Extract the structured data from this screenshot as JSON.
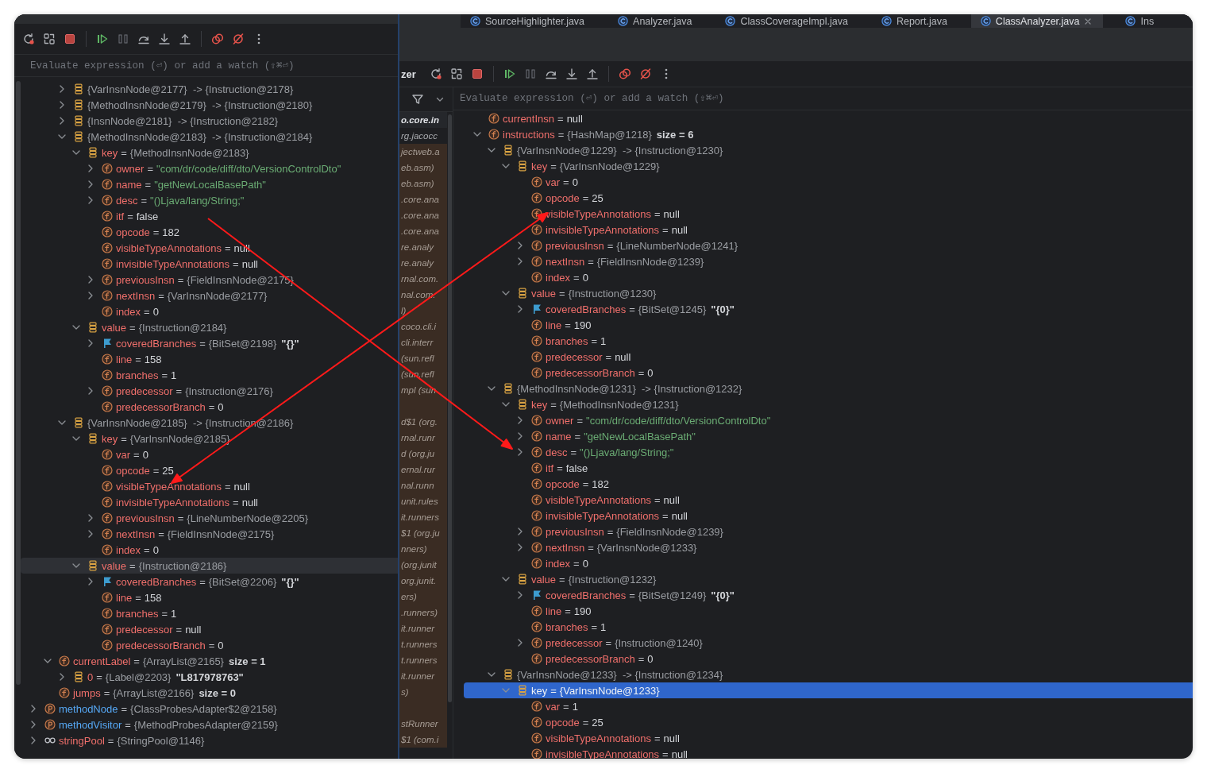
{
  "left_panel": {
    "focused": false,
    "evaluate_field": {
      "placeholder": "Evaluate expression (⏎) or add a watch (⇧⌘⏎)"
    },
    "tree": [
      {
        "children": [
          {
            "children": [
              {
                "kind": "entry",
                "value": {
                  "kind": "object",
                  "text": "{VarInsnNode@2177}  -> {Instruction@2178}"
                },
                "expanded": false,
                "selected": false
              },
              {
                "kind": "entry",
                "value": {
                  "kind": "object",
                  "text": "{MethodInsnNode@2179}  -> {Instruction@2180}"
                },
                "expanded": false,
                "selected": false
              },
              {
                "kind": "entry",
                "value": {
                  "kind": "object",
                  "text": "{InsnNode@2181}  -> {Instruction@2182}"
                },
                "expanded": false,
                "selected": false
              },
              {
                "kind": "entry",
                "value": {
                  "kind": "object",
                  "text": "{MethodInsnNode@2183}  -> {Instruction@2184}"
                },
                "expanded": true,
                "selected": false,
                "children": [
                  {
                    "kind": "entry",
                    "name": "key",
                    "sep": "=",
                    "value": {
                      "kind": "object",
                      "text": "{MethodInsnNode@2183}"
                    },
                    "expanded": true,
                    "selected": false,
                    "children": [
                      {
                        "kind": "field",
                        "name": "owner",
                        "sep": "=",
                        "value": {
                          "kind": "string",
                          "text": "\"com/dr/code/diff/dto/VersionControlDto\""
                        },
                        "expanded": false,
                        "selected": false
                      },
                      {
                        "kind": "field",
                        "name": "name",
                        "sep": "=",
                        "value": {
                          "kind": "string",
                          "text": "\"getNewLocalBasePath\""
                        },
                        "expanded": false,
                        "selected": false
                      },
                      {
                        "kind": "field",
                        "name": "desc",
                        "sep": "=",
                        "value": {
                          "kind": "string",
                          "text": "\"()Ljava/lang/String;\""
                        },
                        "expanded": false,
                        "selected": false
                      },
                      {
                        "kind": "field",
                        "name": "itf",
                        "sep": "=",
                        "value": {
                          "kind": "literal",
                          "text": "false"
                        },
                        "selected": false
                      },
                      {
                        "kind": "field",
                        "name": "opcode",
                        "sep": "=",
                        "value": {
                          "kind": "literal",
                          "text": "182"
                        },
                        "selected": false
                      },
                      {
                        "kind": "field",
                        "name": "visibleTypeAnnotations",
                        "sep": "=",
                        "value": {
                          "kind": "literal",
                          "text": "null"
                        },
                        "selected": false
                      },
                      {
                        "kind": "field",
                        "name": "invisibleTypeAnnotations",
                        "sep": "=",
                        "value": {
                          "kind": "literal",
                          "text": "null"
                        },
                        "selected": false
                      },
                      {
                        "kind": "field",
                        "name": "previousInsn",
                        "sep": "=",
                        "value": {
                          "kind": "object",
                          "text": "{FieldInsnNode@2175}"
                        },
                        "expanded": false,
                        "selected": false
                      },
                      {
                        "kind": "field",
                        "name": "nextInsn",
                        "sep": "=",
                        "value": {
                          "kind": "object",
                          "text": "{VarInsnNode@2177}"
                        },
                        "expanded": false,
                        "selected": false
                      },
                      {
                        "kind": "field",
                        "name": "index",
                        "sep": "=",
                        "value": {
                          "kind": "literal",
                          "text": "0"
                        },
                        "selected": false
                      }
                    ]
                  },
                  {
                    "kind": "entry",
                    "name": "value",
                    "sep": "=",
                    "value": {
                      "kind": "object",
                      "text": "{Instruction@2184}"
                    },
                    "expanded": true,
                    "selected": false,
                    "children": [
                      {
                        "kind": "flag",
                        "name": "coveredBranches",
                        "sep": "=",
                        "value": {
                          "kind": "object",
                          "text": "{BitSet@2198}"
                        },
                        "extra": "\"{}\"",
                        "expanded": false,
                        "selected": false
                      },
                      {
                        "kind": "field",
                        "name": "line",
                        "sep": "=",
                        "value": {
                          "kind": "literal",
                          "text": "158"
                        },
                        "selected": false
                      },
                      {
                        "kind": "field",
                        "name": "branches",
                        "sep": "=",
                        "value": {
                          "kind": "literal",
                          "text": "1"
                        },
                        "selected": false
                      },
                      {
                        "kind": "field",
                        "name": "predecessor",
                        "sep": "=",
                        "value": {
                          "kind": "object",
                          "text": "{Instruction@2176}"
                        },
                        "expanded": false,
                        "selected": false
                      },
                      {
                        "kind": "field",
                        "name": "predecessorBranch",
                        "sep": "=",
                        "value": {
                          "kind": "literal",
                          "text": "0"
                        },
                        "selected": false
                      }
                    ]
                  }
                ]
              },
              {
                "kind": "entry",
                "value": {
                  "kind": "object",
                  "text": "{VarInsnNode@2185}  -> {Instruction@2186}"
                },
                "expanded": true,
                "selected": false,
                "children": [
                  {
                    "kind": "entry",
                    "name": "key",
                    "sep": "=",
                    "value": {
                      "kind": "object",
                      "text": "{VarInsnNode@2185}"
                    },
                    "expanded": true,
                    "selected": false,
                    "children": [
                      {
                        "kind": "field",
                        "name": "var",
                        "sep": "=",
                        "value": {
                          "kind": "literal",
                          "text": "0"
                        },
                        "selected": false
                      },
                      {
                        "kind": "field",
                        "name": "opcode",
                        "sep": "=",
                        "value": {
                          "kind": "literal",
                          "text": "25"
                        },
                        "selected": false
                      },
                      {
                        "kind": "field",
                        "name": "visibleTypeAnnotations",
                        "sep": "=",
                        "value": {
                          "kind": "literal",
                          "text": "null"
                        },
                        "selected": false
                      },
                      {
                        "kind": "field",
                        "name": "invisibleTypeAnnotations",
                        "sep": "=",
                        "value": {
                          "kind": "literal",
                          "text": "null"
                        },
                        "selected": false
                      },
                      {
                        "kind": "field",
                        "name": "previousInsn",
                        "sep": "=",
                        "value": {
                          "kind": "object",
                          "text": "{LineNumberNode@2205}"
                        },
                        "expanded": false,
                        "selected": false
                      },
                      {
                        "kind": "field",
                        "name": "nextInsn",
                        "sep": "=",
                        "value": {
                          "kind": "object",
                          "text": "{FieldInsnNode@2175}"
                        },
                        "expanded": false,
                        "selected": false
                      },
                      {
                        "kind": "field",
                        "name": "index",
                        "sep": "=",
                        "value": {
                          "kind": "literal",
                          "text": "0"
                        },
                        "selected": false
                      }
                    ]
                  },
                  {
                    "kind": "entry",
                    "name": "value",
                    "sep": "=",
                    "value": {
                      "kind": "object",
                      "text": "{Instruction@2186}"
                    },
                    "expanded": true,
                    "selected": true,
                    "children": [
                      {
                        "kind": "flag",
                        "name": "coveredBranches",
                        "sep": "=",
                        "value": {
                          "kind": "object",
                          "text": "{BitSet@2206}"
                        },
                        "extra": "\"{}\"",
                        "expanded": false,
                        "selected": false
                      },
                      {
                        "kind": "field",
                        "name": "line",
                        "sep": "=",
                        "value": {
                          "kind": "literal",
                          "text": "158"
                        },
                        "selected": false
                      },
                      {
                        "kind": "field",
                        "name": "branches",
                        "sep": "=",
                        "value": {
                          "kind": "literal",
                          "text": "1"
                        },
                        "selected": false
                      },
                      {
                        "kind": "field",
                        "name": "predecessor",
                        "sep": "=",
                        "value": {
                          "kind": "literal",
                          "text": "null"
                        },
                        "selected": false
                      },
                      {
                        "kind": "field",
                        "name": "predecessorBranch",
                        "sep": "=",
                        "value": {
                          "kind": "literal",
                          "text": "0"
                        },
                        "selected": false
                      }
                    ]
                  }
                ]
              }
            ]
          },
          {
            "kind": "field",
            "name": "currentLabel",
            "sep": "=",
            "value": {
              "kind": "object",
              "text": "{ArrayList@2165}"
            },
            "extra": "size = 1",
            "expanded": true,
            "selected": false,
            "children": [
              {
                "kind": "entry",
                "name": "0",
                "sep": "=",
                "value": {
                  "kind": "object",
                  "text": "{Label@2203}"
                },
                "extra": "\"L817978763\"",
                "expanded": false,
                "selected": false
              }
            ]
          },
          {
            "kind": "field",
            "name": "jumps",
            "sep": "=",
            "value": {
              "kind": "object",
              "text": "{ArrayList@2166}"
            },
            "extra": "size = 0",
            "selected": false
          }
        ]
      },
      {
        "kind": "protected",
        "name": "methodNode",
        "sep": "=",
        "value": {
          "kind": "object",
          "text": "{ClassProbesAdapter$2@2158}"
        },
        "expanded": false,
        "selected": false
      },
      {
        "kind": "protected",
        "name": "methodVisitor",
        "sep": "=",
        "value": {
          "kind": "object",
          "text": "{MethodProbesAdapter@2159}"
        },
        "expanded": false,
        "selected": false
      },
      {
        "kind": "watch",
        "name": "stringPool",
        "sep": "=",
        "value": {
          "kind": "object",
          "text": "{StringPool@1146}"
        },
        "expanded": false,
        "selected": false
      }
    ]
  },
  "right_window": {
    "tabs": [
      {
        "label": "SourceHighlighter.java",
        "selected": false
      },
      {
        "label": "Analyzer.java",
        "selected": false
      },
      {
        "label": "ClassCoverageImpl.java",
        "selected": false
      },
      {
        "label": "Report.java",
        "selected": false
      },
      {
        "label": "ClassAnalyzer.java",
        "selected": true
      },
      {
        "label": "Ins",
        "selected": false
      }
    ],
    "debug_label": "zer",
    "frames": [
      {
        "text": "o.core.in",
        "selected": true,
        "library": false
      },
      {
        "text": "rg.jacocc",
        "selected": false,
        "library": false
      },
      {
        "text": "jectweb.a",
        "selected": false,
        "library": true
      },
      {
        "text": "eb.asm)",
        "selected": false,
        "library": true
      },
      {
        "text": "eb.asm)",
        "selected": false,
        "library": true
      },
      {
        "text": ".core.ana",
        "selected": false,
        "library": true
      },
      {
        "text": ".core.ana",
        "selected": false,
        "library": true
      },
      {
        "text": ".core.ana",
        "selected": false,
        "library": true
      },
      {
        "text": "re.analy",
        "selected": false,
        "library": true
      },
      {
        "text": "re.analy",
        "selected": false,
        "library": true
      },
      {
        "text": "rnal.com.",
        "selected": false,
        "library": true
      },
      {
        "text": "nal.com.",
        "selected": false,
        "library": true
      },
      {
        "text": "l)",
        "selected": false,
        "library": true
      },
      {
        "text": "coco.cli.i",
        "selected": false,
        "library": true
      },
      {
        "text": "cli.interr",
        "selected": false,
        "library": true
      },
      {
        "text": "(sun.refl",
        "selected": false,
        "library": true
      },
      {
        "text": "(sun.refl",
        "selected": false,
        "library": true
      },
      {
        "text": "mpl (sun",
        "selected": false,
        "library": true
      },
      {
        "selected": false,
        "library": true
      },
      {
        "text": "d$1 (org.",
        "selected": false,
        "library": true
      },
      {
        "text": "rnal.runr",
        "selected": false,
        "library": true
      },
      {
        "text": "d (org.ju",
        "selected": false,
        "library": true
      },
      {
        "text": "ernal.rur",
        "selected": false,
        "library": true
      },
      {
        "text": "nal.runn",
        "selected": false,
        "library": true
      },
      {
        "text": "unit.rules",
        "selected": false,
        "library": true
      },
      {
        "text": "it.runners",
        "selected": false,
        "library": true
      },
      {
        "text": "$1 (org.ju",
        "selected": false,
        "library": true
      },
      {
        "text": "nners)",
        "selected": false,
        "library": true
      },
      {
        "text": "(org.junit",
        "selected": false,
        "library": true
      },
      {
        "text": "org.junit.",
        "selected": false,
        "library": true
      },
      {
        "text": "ers)",
        "selected": false,
        "library": true
      },
      {
        "text": ".runners)",
        "selected": false,
        "library": true
      },
      {
        "text": "it.runner",
        "selected": false,
        "library": true
      },
      {
        "text": "t.runners",
        "selected": false,
        "library": true
      },
      {
        "text": "t.runners",
        "selected": false,
        "library": true
      },
      {
        "text": "it.runner",
        "selected": false,
        "library": true
      },
      {
        "text": "s)",
        "selected": false,
        "library": true
      },
      {
        "selected": false,
        "library": true
      },
      {
        "text": "stRunner",
        "selected": false,
        "library": true
      },
      {
        "text": "$1 (com.i",
        "selected": false,
        "library": true
      }
    ],
    "variables": {
      "focused": true,
      "evaluate_field": {
        "placeholder": "Evaluate expression (⏎) or add a watch (⇧⌘⏎)"
      },
      "tree": [
        {
          "kind": "field",
          "name": "currentInsn",
          "sep": "=",
          "value": {
            "kind": "literal",
            "text": "null"
          },
          "selected": false
        },
        {
          "kind": "field",
          "name": "instructions",
          "sep": "=",
          "value": {
            "kind": "object",
            "text": "{HashMap@1218}"
          },
          "extra": "size = 6",
          "expanded": true,
          "selected": false,
          "children": [
            {
              "kind": "entry",
              "value": {
                "kind": "object",
                "text": "{VarInsnNode@1229}  -> {Instruction@1230}"
              },
              "expanded": true,
              "selected": false,
              "children": [
                {
                  "kind": "entry",
                  "name": "key",
                  "sep": "=",
                  "value": {
                    "kind": "object",
                    "text": "{VarInsnNode@1229}"
                  },
                  "expanded": true,
                  "selected": false,
                  "children": [
                    {
                      "kind": "field",
                      "name": "var",
                      "sep": "=",
                      "value": {
                        "kind": "literal",
                        "text": "0"
                      },
                      "selected": false
                    },
                    {
                      "kind": "field",
                      "name": "opcode",
                      "sep": "=",
                      "value": {
                        "kind": "literal",
                        "text": "25"
                      },
                      "selected": false
                    },
                    {
                      "kind": "field",
                      "name": "visibleTypeAnnotations",
                      "sep": "=",
                      "value": {
                        "kind": "literal",
                        "text": "null"
                      },
                      "selected": false
                    },
                    {
                      "kind": "field",
                      "name": "invisibleTypeAnnotations",
                      "sep": "=",
                      "value": {
                        "kind": "literal",
                        "text": "null"
                      },
                      "selected": false
                    },
                    {
                      "kind": "field",
                      "name": "previousInsn",
                      "sep": "=",
                      "value": {
                        "kind": "object",
                        "text": "{LineNumberNode@1241}"
                      },
                      "expanded": false,
                      "selected": false
                    },
                    {
                      "kind": "field",
                      "name": "nextInsn",
                      "sep": "=",
                      "value": {
                        "kind": "object",
                        "text": "{FieldInsnNode@1239}"
                      },
                      "expanded": false,
                      "selected": false
                    },
                    {
                      "kind": "field",
                      "name": "index",
                      "sep": "=",
                      "value": {
                        "kind": "literal",
                        "text": "0"
                      },
                      "selected": false
                    }
                  ]
                },
                {
                  "kind": "entry",
                  "name": "value",
                  "sep": "=",
                  "value": {
                    "kind": "object",
                    "text": "{Instruction@1230}"
                  },
                  "expanded": true,
                  "selected": false,
                  "children": [
                    {
                      "kind": "flag",
                      "name": "coveredBranches",
                      "sep": "=",
                      "value": {
                        "kind": "object",
                        "text": "{BitSet@1245}"
                      },
                      "extra": "\"{0}\"",
                      "expanded": false,
                      "selected": false
                    },
                    {
                      "kind": "field",
                      "name": "line",
                      "sep": "=",
                      "value": {
                        "kind": "literal",
                        "text": "190"
                      },
                      "selected": false
                    },
                    {
                      "kind": "field",
                      "name": "branches",
                      "sep": "=",
                      "value": {
                        "kind": "literal",
                        "text": "1"
                      },
                      "selected": false
                    },
                    {
                      "kind": "field",
                      "name": "predecessor",
                      "sep": "=",
                      "value": {
                        "kind": "literal",
                        "text": "null"
                      },
                      "selected": false
                    },
                    {
                      "kind": "field",
                      "name": "predecessorBranch",
                      "sep": "=",
                      "value": {
                        "kind": "literal",
                        "text": "0"
                      },
                      "selected": false
                    }
                  ]
                }
              ]
            },
            {
              "kind": "entry",
              "value": {
                "kind": "object",
                "text": "{MethodInsnNode@1231}  -> {Instruction@1232}"
              },
              "expanded": true,
              "selected": false,
              "children": [
                {
                  "kind": "entry",
                  "name": "key",
                  "sep": "=",
                  "value": {
                    "kind": "object",
                    "text": "{MethodInsnNode@1231}"
                  },
                  "expanded": true,
                  "selected": false,
                  "children": [
                    {
                      "kind": "field",
                      "name": "owner",
                      "sep": "=",
                      "value": {
                        "kind": "string",
                        "text": "\"com/dr/code/diff/dto/VersionControlDto\""
                      },
                      "expanded": false,
                      "selected": false
                    },
                    {
                      "kind": "field",
                      "name": "name",
                      "sep": "=",
                      "value": {
                        "kind": "string",
                        "text": "\"getNewLocalBasePath\""
                      },
                      "expanded": false,
                      "selected": false
                    },
                    {
                      "kind": "field",
                      "name": "desc",
                      "sep": "=",
                      "value": {
                        "kind": "string",
                        "text": "\"()Ljava/lang/String;\""
                      },
                      "expanded": false,
                      "selected": false
                    },
                    {
                      "kind": "field",
                      "name": "itf",
                      "sep": "=",
                      "value": {
                        "kind": "literal",
                        "text": "false"
                      },
                      "selected": false
                    },
                    {
                      "kind": "field",
                      "name": "opcode",
                      "sep": "=",
                      "value": {
                        "kind": "literal",
                        "text": "182"
                      },
                      "selected": false
                    },
                    {
                      "kind": "field",
                      "name": "visibleTypeAnnotations",
                      "sep": "=",
                      "value": {
                        "kind": "literal",
                        "text": "null"
                      },
                      "selected": false
                    },
                    {
                      "kind": "field",
                      "name": "invisibleTypeAnnotations",
                      "sep": "=",
                      "value": {
                        "kind": "literal",
                        "text": "null"
                      },
                      "selected": false
                    },
                    {
                      "kind": "field",
                      "name": "previousInsn",
                      "sep": "=",
                      "value": {
                        "kind": "object",
                        "text": "{FieldInsnNode@1239}"
                      },
                      "expanded": false,
                      "selected": false
                    },
                    {
                      "kind": "field",
                      "name": "nextInsn",
                      "sep": "=",
                      "value": {
                        "kind": "object",
                        "text": "{VarInsnNode@1233}"
                      },
                      "expanded": false,
                      "selected": false
                    },
                    {
                      "kind": "field",
                      "name": "index",
                      "sep": "=",
                      "value": {
                        "kind": "literal",
                        "text": "0"
                      },
                      "selected": false
                    }
                  ]
                },
                {
                  "kind": "entry",
                  "name": "value",
                  "sep": "=",
                  "value": {
                    "kind": "object",
                    "text": "{Instruction@1232}"
                  },
                  "expanded": true,
                  "selected": false,
                  "children": [
                    {
                      "kind": "flag",
                      "name": "coveredBranches",
                      "sep": "=",
                      "value": {
                        "kind": "object",
                        "text": "{BitSet@1249}"
                      },
                      "extra": "\"{0}\"",
                      "expanded": false,
                      "selected": false
                    },
                    {
                      "kind": "field",
                      "name": "line",
                      "sep": "=",
                      "value": {
                        "kind": "literal",
                        "text": "190"
                      },
                      "selected": false
                    },
                    {
                      "kind": "field",
                      "name": "branches",
                      "sep": "=",
                      "value": {
                        "kind": "literal",
                        "text": "1"
                      },
                      "selected": false
                    },
                    {
                      "kind": "field",
                      "name": "predecessor",
                      "sep": "=",
                      "value": {
                        "kind": "object",
                        "text": "{Instruction@1240}"
                      },
                      "expanded": false,
                      "selected": false
                    },
                    {
                      "kind": "field",
                      "name": "predecessorBranch",
                      "sep": "=",
                      "value": {
                        "kind": "literal",
                        "text": "0"
                      },
                      "selected": false
                    }
                  ]
                }
              ]
            },
            {
              "kind": "entry",
              "value": {
                "kind": "object",
                "text": "{VarInsnNode@1233}  -> {Instruction@1234}"
              },
              "expanded": true,
              "selected": false,
              "children": [
                {
                  "kind": "entry",
                  "name": "key",
                  "sep": "=",
                  "value": {
                    "kind": "object",
                    "text": "{VarInsnNode@1233}"
                  },
                  "expanded": true,
                  "selected": true,
                  "children": [
                    {
                      "kind": "field",
                      "name": "var",
                      "sep": "=",
                      "value": {
                        "kind": "literal",
                        "text": "1"
                      },
                      "selected": false
                    },
                    {
                      "kind": "field",
                      "name": "opcode",
                      "sep": "=",
                      "value": {
                        "kind": "literal",
                        "text": "25"
                      },
                      "selected": false
                    },
                    {
                      "kind": "field",
                      "name": "visibleTypeAnnotations",
                      "sep": "=",
                      "value": {
                        "kind": "literal",
                        "text": "null"
                      },
                      "selected": false
                    },
                    {
                      "kind": "field",
                      "name": "invisibleTypeAnnotations",
                      "sep": "=",
                      "value": {
                        "kind": "literal",
                        "text": "null"
                      },
                      "selected": false
                    }
                  ]
                }
              ]
            }
          ]
        }
      ]
    }
  }
}
